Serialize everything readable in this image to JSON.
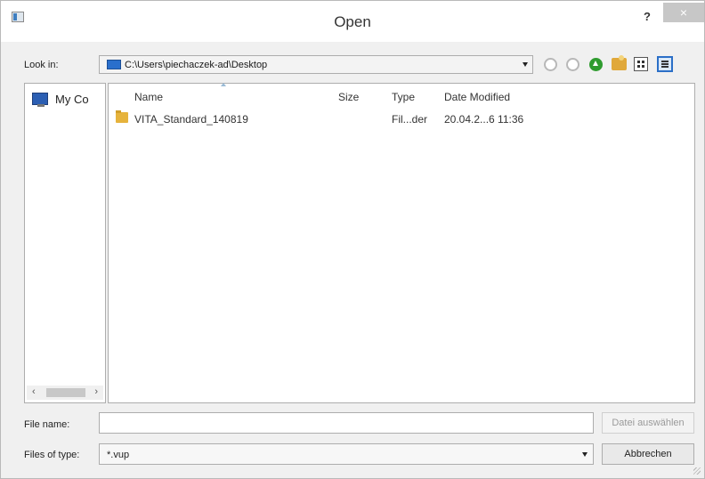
{
  "window": {
    "title": "Open"
  },
  "titlebar": {
    "help": "?",
    "close": "×"
  },
  "lookin": {
    "label": "Look in:",
    "path": "C:\\Users\\piechaczek-ad\\Desktop"
  },
  "toolbar": {
    "icons": [
      "back-icon",
      "forward-icon",
      "parent-directory-icon",
      "new-folder-icon",
      "list-view-icon",
      "detail-view-icon"
    ]
  },
  "sidebar": {
    "items": [
      {
        "label": "My Co",
        "icon": "computer-icon"
      }
    ],
    "scroll": {
      "left": "‹",
      "right": "›"
    }
  },
  "filelist": {
    "columns": [
      "Name",
      "Size",
      "Type",
      "Date Modified"
    ],
    "rows": [
      {
        "name": "VITA_Standard_140819",
        "size": "",
        "type": "Fil...der",
        "date": "20.04.2...6 11:36",
        "icon": "folder-icon"
      }
    ]
  },
  "filename": {
    "label": "File name:",
    "value": "",
    "action": "Datei auswählen"
  },
  "filetype": {
    "label": "Files of type:",
    "value": "*.vup",
    "cancel": "Abbrechen"
  },
  "colors": {
    "accent": "#2b6fc7",
    "folder": "#e6b33c"
  }
}
